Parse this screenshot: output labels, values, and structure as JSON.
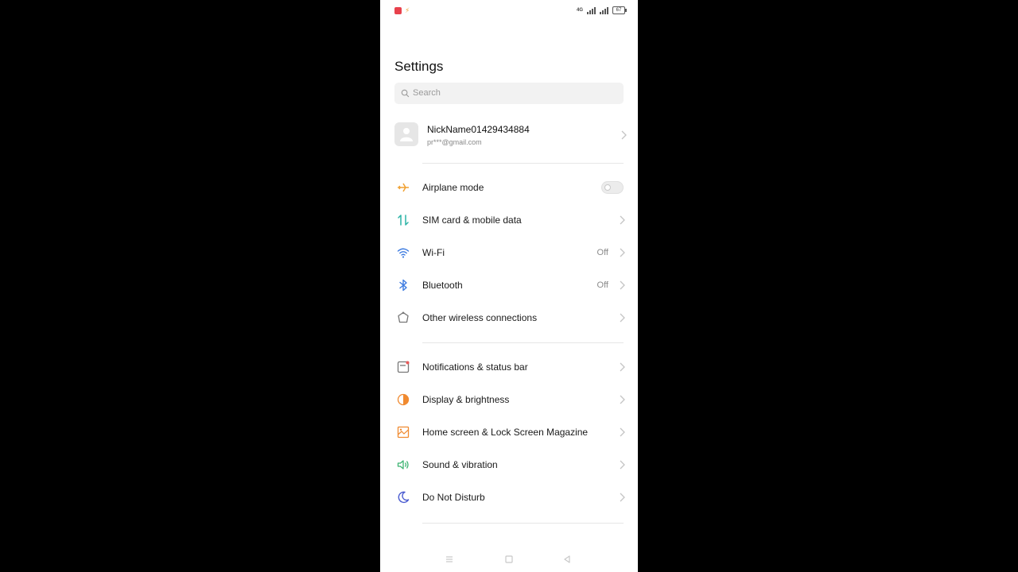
{
  "status_bar": {
    "network_label": "4G",
    "battery_level": "67"
  },
  "page_title": "Settings",
  "search": {
    "placeholder": "Search"
  },
  "account": {
    "name": "NickName01429434884",
    "email": "pr***@gmail.com"
  },
  "sections": [
    {
      "items": [
        {
          "label": "Airplane mode",
          "icon": "airplane-icon",
          "toggle": "off"
        },
        {
          "label": "SIM card & mobile data",
          "icon": "sim-data-icon"
        },
        {
          "label": "Wi-Fi",
          "icon": "wifi-icon",
          "value": "Off"
        },
        {
          "label": "Bluetooth",
          "icon": "bluetooth-icon",
          "value": "Off"
        },
        {
          "label": "Other wireless connections",
          "icon": "wireless-connections-icon"
        }
      ]
    },
    {
      "items": [
        {
          "label": "Notifications & status bar",
          "icon": "notifications-icon"
        },
        {
          "label": "Display & brightness",
          "icon": "display-brightness-icon"
        },
        {
          "label": "Home screen & Lock Screen Magazine",
          "icon": "home-screen-icon"
        },
        {
          "label": "Sound & vibration",
          "icon": "sound-icon"
        },
        {
          "label": "Do Not Disturb",
          "icon": "moon-icon"
        }
      ]
    }
  ],
  "colors": {
    "airplane": "#f0a030",
    "sim": "#2bb3a6",
    "wifi": "#3d7be0",
    "bluetooth": "#3d7be0",
    "wireless": "#777777",
    "notifications": "#e85a5a",
    "display": "#f08a30",
    "home": "#f08a30",
    "sound": "#3cb371",
    "moon": "#4a5bd0"
  },
  "nav_bar": {
    "buttons": [
      "menu-icon",
      "home-icon",
      "back-icon"
    ]
  }
}
